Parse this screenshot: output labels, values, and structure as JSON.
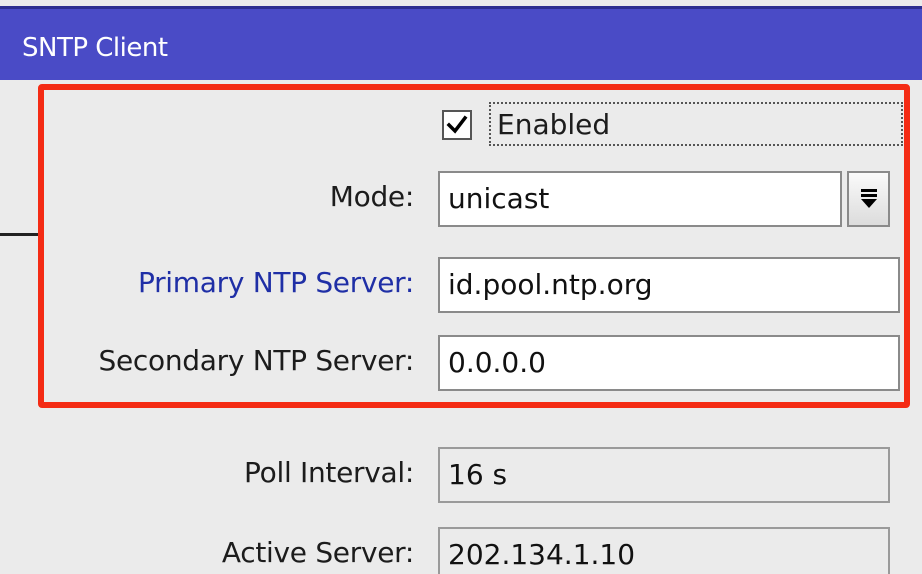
{
  "window": {
    "title": "SNTP Client"
  },
  "enabled": {
    "label": "Enabled",
    "checked": true
  },
  "mode": {
    "label": "Mode:",
    "value": "unicast",
    "dropdown_icon": "dropdown-arrow-icon"
  },
  "primary_ntp": {
    "label": "Primary NTP Server:",
    "value": "id.pool.ntp.org"
  },
  "secondary_ntp": {
    "label": "Secondary NTP Server:",
    "value": "0.0.0.0"
  },
  "poll_interval": {
    "label": "Poll Interval:",
    "value": "16 s"
  },
  "active_server": {
    "label": "Active Server:",
    "value": "202.134.1.10"
  },
  "colors": {
    "titlebar": "#4a4bc6",
    "highlight": "#f42b14",
    "link_label": "#1f2fa6"
  }
}
